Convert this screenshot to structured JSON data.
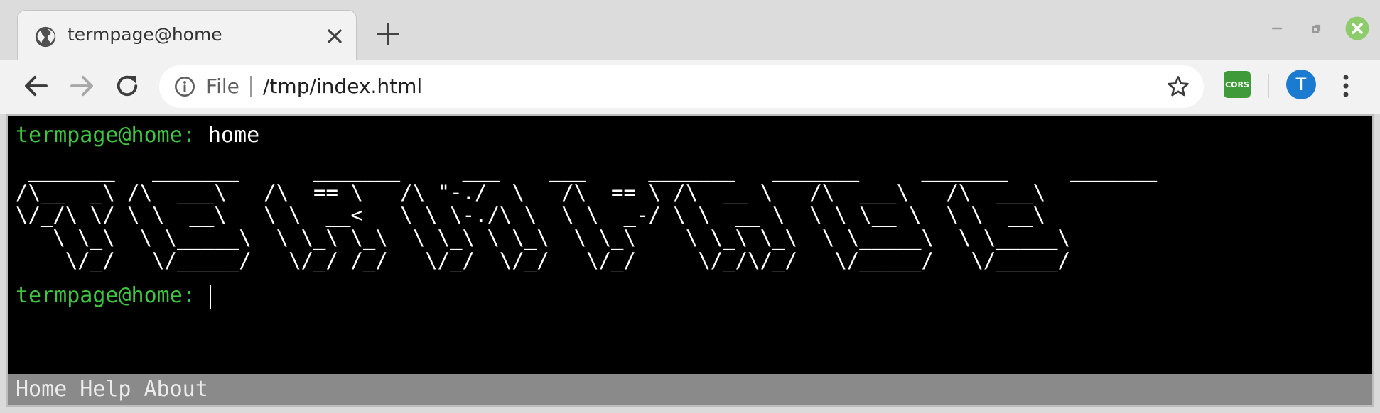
{
  "tab": {
    "title": "termpage@home",
    "icon": "globe-icon"
  },
  "toolbar": {
    "scheme": "File",
    "url": "/tmp/index.html",
    "extension_label": "CORS",
    "avatar_initial": "T"
  },
  "terminal": {
    "prompt": "termpage@home:",
    "history_command": "home",
    "banner": " _______   _______      _______     ___    ___     _______   _______     _______     _______\n/\\__  _\\ /\\  ___\\   /\\  == \\   /\\ \"-./  \\   /\\  == \\ /\\  __ \\   /\\  ___\\   /\\  ___\\\n\\/_/\\ \\/ \\ \\  __\\   \\ \\  __<   \\ \\ \\-./\\ \\  \\ \\  _-/ \\ \\  __ \\  \\ \\ \\__ \\  \\ \\  __\\\n   \\ \\_\\  \\ \\_____\\  \\ \\_\\ \\_\\  \\ \\_\\ \\ \\_\\  \\ \\_\\    \\ \\_\\ \\_\\  \\ \\_____\\  \\ \\_____\\\n    \\/_/   \\/_____/   \\/_/ /_/   \\/_/  \\/_/   \\/_/     \\/_/\\/_/   \\/_____/   \\/_____/",
    "current_input": ""
  },
  "footer": {
    "links": [
      "Home",
      "Help",
      "About"
    ]
  },
  "colors": {
    "prompt_green": "#3ec73e",
    "terminal_bg": "#000000",
    "footer_bg": "#8a8a8a",
    "avatar_blue": "#1a7bd0",
    "cors_green": "#3f9b3a"
  }
}
